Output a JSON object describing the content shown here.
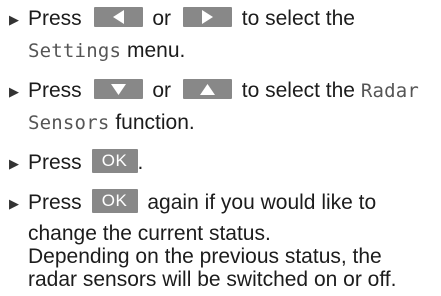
{
  "steps": [
    {
      "lines": [
        [
          "Press",
          "or",
          "to select the"
        ],
        [
          "Settings",
          "menu."
        ]
      ]
    },
    {
      "lines": [
        [
          "Press",
          "or",
          "to select the",
          "Radar"
        ],
        [
          "Sensors",
          "function."
        ]
      ]
    },
    {
      "lines": [
        [
          "Press",
          "."
        ]
      ]
    },
    {
      "lines": [
        [
          "Press",
          "again if you would like to"
        ],
        [
          "change the current status."
        ],
        [
          "Depending on the previous status, the"
        ],
        [
          "radar sensors will be switched on or off."
        ]
      ]
    }
  ],
  "keys": {
    "left": "left-arrow-key",
    "right": "right-arrow-key",
    "down": "down-arrow-key",
    "up": "up-arrow-key",
    "ok": "OK"
  },
  "colors": {
    "key_bg": "#888888",
    "key_glyph": "#ffffff",
    "text": "#1c1c1c",
    "display_text": "#555555"
  }
}
